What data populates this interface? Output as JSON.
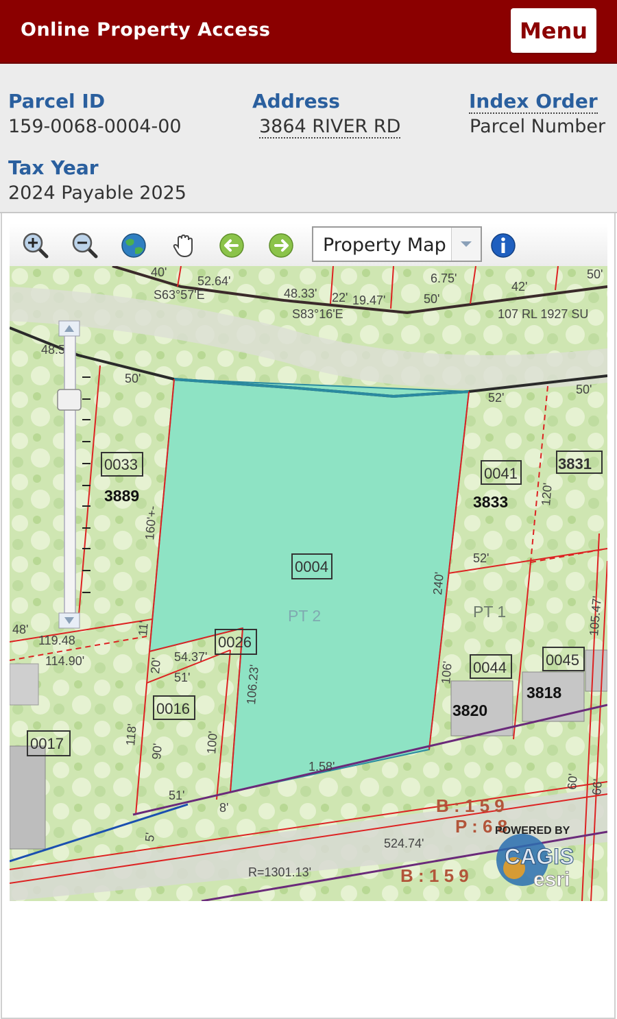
{
  "header": {
    "title": "Online Property Access",
    "menu_label": "Menu"
  },
  "info": {
    "parcel_id_label": "Parcel ID",
    "parcel_id_value": "159-0068-0004-00",
    "address_label": "Address",
    "address_value": "3864 RIVER RD",
    "index_order_label": "Index Order",
    "index_order_value": "Parcel Number",
    "tax_year_label": "Tax Year",
    "tax_year_value": "2024 Payable 2025"
  },
  "toolbar": {
    "icons": [
      "zoom-in-icon",
      "zoom-out-icon",
      "globe-icon",
      "pan-hand-icon",
      "back-arrow-icon",
      "forward-arrow-icon",
      "info-icon"
    ],
    "map_type_selected": "Property Map",
    "accent_color": "#2a5f9e"
  },
  "map": {
    "parcel_labels": [
      "0033",
      "0041",
      "3831",
      "0004",
      "0026",
      "0016",
      "0017",
      "0044",
      "0045"
    ],
    "address_numbers": [
      "3889",
      "3833",
      "3820",
      "3818"
    ],
    "section_labels": [
      "PT 2",
      "PT 1"
    ],
    "dimension_labels": [
      "40'",
      "52.64'",
      "S63°57'E",
      "48.33'",
      "22'",
      "19.47'",
      "6.75'",
      "50'",
      "42'",
      "50'",
      "S83°16'E",
      "107 RL 1927 SU",
      "48.5",
      "50'",
      "52'",
      "50'",
      "160'+-",
      "120'",
      "240'",
      "52'",
      "105.47'",
      "48'",
      "119.48",
      "114.90'",
      "11'",
      "20'",
      "54.37'",
      "51'",
      "106.23'",
      "118'",
      "90'",
      "100'",
      "106'",
      "1.58'",
      "51'",
      "8'",
      "5'",
      "524.74'",
      "R=1301.13'",
      "60'",
      "66'"
    ],
    "book_page": [
      "B : 1 5 9",
      "P : 6 8",
      "B : 1 5 9"
    ],
    "logo_text": [
      "POWERED BY",
      "CAGIS",
      "esri"
    ],
    "selected_parcel_color": "#8ee3c4"
  }
}
